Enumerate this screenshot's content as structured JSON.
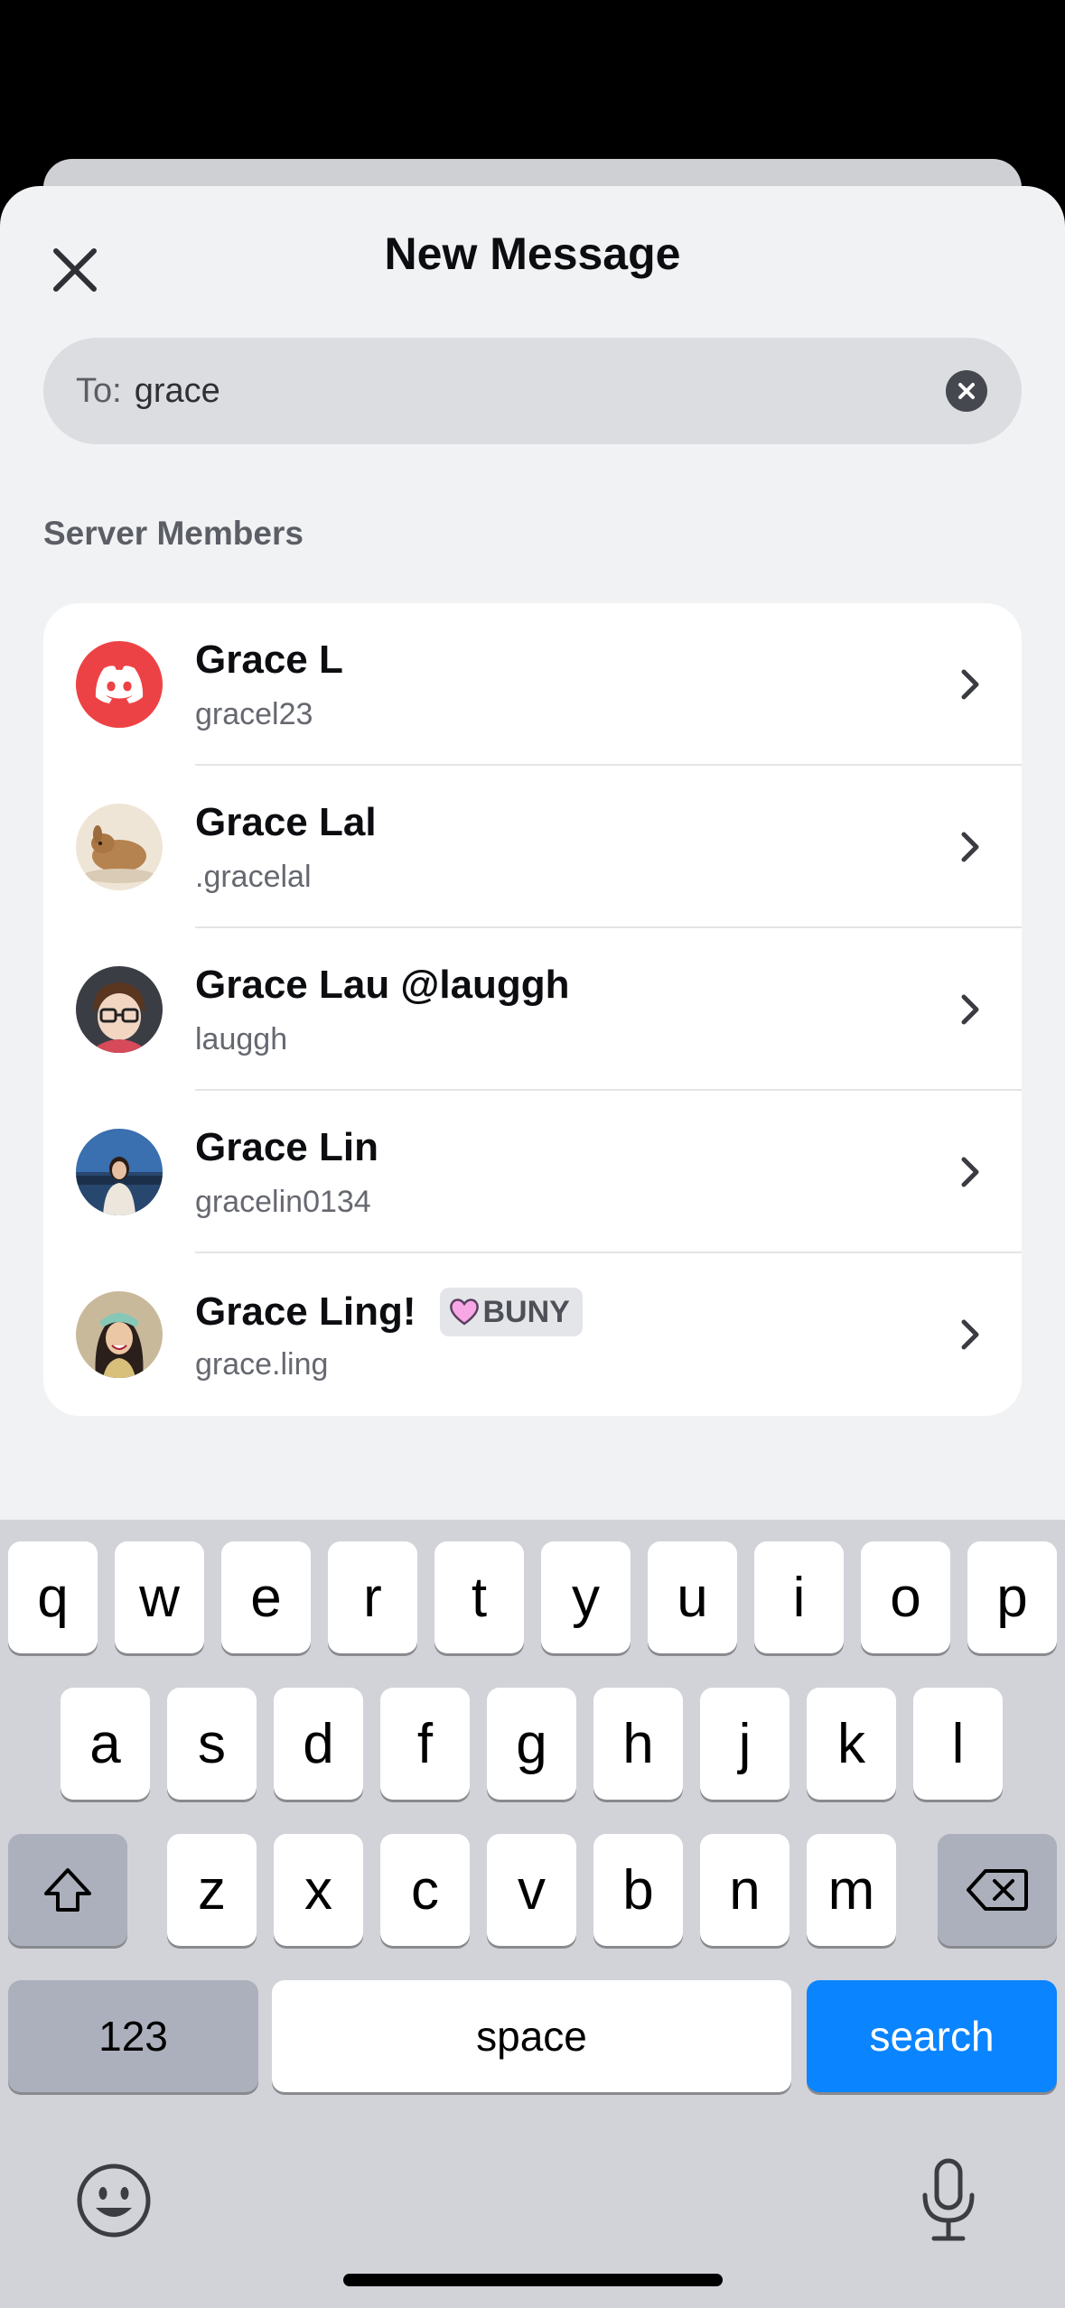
{
  "header": {
    "title": "New Message"
  },
  "to_field": {
    "label": "To:",
    "value": "grace"
  },
  "section": {
    "label": "Server Members"
  },
  "members": [
    {
      "name": "Grace L",
      "username": "gracel23",
      "avatar": "discord-logo-red"
    },
    {
      "name": "Grace Lal",
      "username": ".gracelal",
      "avatar": "bunny-photo"
    },
    {
      "name": "Grace Lau @lauggh",
      "username": "lauggh",
      "avatar": "cartoon-glasses"
    },
    {
      "name": "Grace Lin",
      "username": "gracelin0134",
      "avatar": "person-photo"
    },
    {
      "name": "Grace Ling!",
      "username": "grace.ling",
      "avatar": "person-photo-2",
      "tag": {
        "icon": "pink-heart",
        "text": "BUNY"
      }
    }
  ],
  "keyboard": {
    "row1": [
      "q",
      "w",
      "e",
      "r",
      "t",
      "y",
      "u",
      "i",
      "o",
      "p"
    ],
    "row2": [
      "a",
      "s",
      "d",
      "f",
      "g",
      "h",
      "j",
      "k",
      "l"
    ],
    "row3": [
      "z",
      "x",
      "c",
      "v",
      "b",
      "n",
      "m"
    ],
    "numbers_label": "123",
    "space_label": "space",
    "search_label": "search"
  },
  "colors": {
    "accent": "#0a84ff",
    "discord_red": "#ed4245",
    "sheet_bg": "#f1f2f4"
  }
}
